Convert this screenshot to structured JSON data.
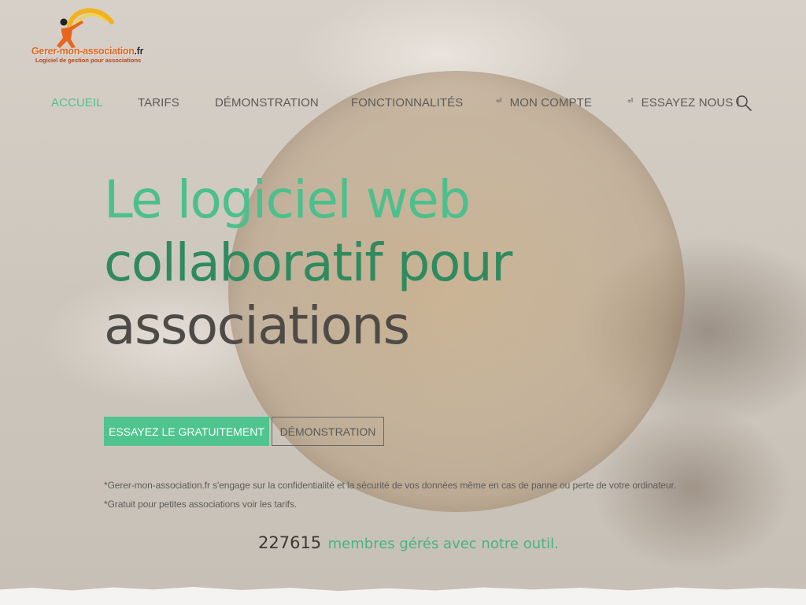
{
  "logo": {
    "name": "Gerer-mon-association",
    "tld": ".fr",
    "tagline": "Logiciel de gestion pour associations"
  },
  "nav": {
    "items": [
      {
        "label": "ACCUEIL",
        "active": true
      },
      {
        "label": "TARIFS",
        "active": false
      },
      {
        "label": "DÉMONSTRATION",
        "active": false
      },
      {
        "label": "FONCTIONNALITÉS",
        "active": false
      },
      {
        "label": "MON COMPTE",
        "active": false,
        "icon": "login-icon"
      },
      {
        "label": "ESSAYEZ NOUS !",
        "active": false,
        "icon": "login-icon"
      }
    ],
    "search_icon": "search-icon"
  },
  "hero": {
    "headline_line1": "Le logiciel web",
    "headline_line2": "collaboratif pour",
    "headline_line3": "associations",
    "cta_primary": "ESSAYEZ LE GRATUITEMENT",
    "cta_secondary": "DÉMONSTRATION",
    "note1": "*Gerer-mon-association.fr s'engage sur la confidentialité et la sécurité de vos données même en cas de panne ou perte de votre ordinateur.",
    "note2": "*Gratuit pour petites associations voir les tarifs.",
    "counter_value": "227615",
    "counter_text": "membres gérés avec notre outil."
  },
  "colors": {
    "accent": "#4fc48f",
    "accent_dark": "#2f8a5f",
    "text_dark": "#4e4a46",
    "logo_orange": "#e2651e"
  }
}
